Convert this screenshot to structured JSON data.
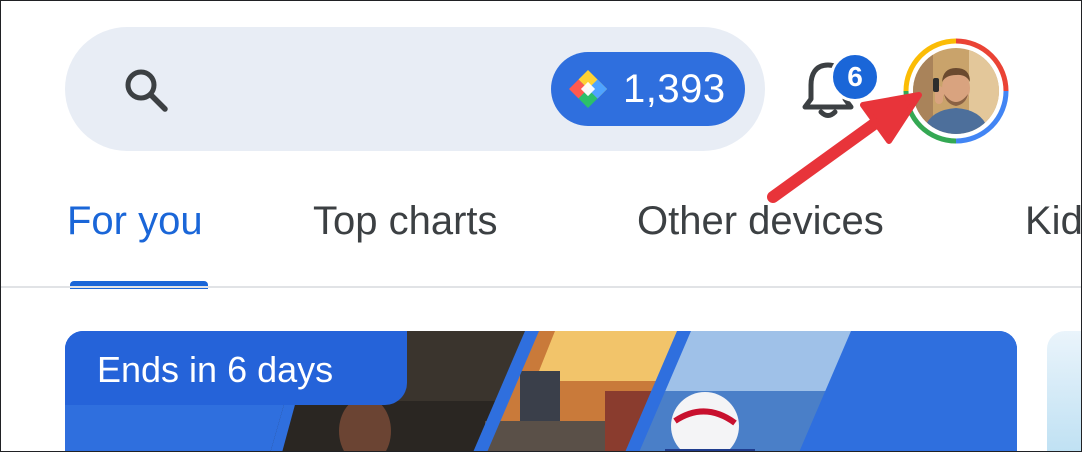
{
  "search": {
    "icon": "search-icon",
    "points": {
      "icon": "play-points-icon",
      "value": "1,393"
    }
  },
  "notifications": {
    "icon": "bell-icon",
    "count": "6"
  },
  "profile": {
    "icon": "avatar"
  },
  "tabs": [
    {
      "label": "For you",
      "active": true
    },
    {
      "label": "Top charts",
      "active": false
    },
    {
      "label": "Other devices",
      "active": false
    },
    {
      "label": "Kid",
      "active": false
    }
  ],
  "banner": {
    "badge": "Ends in 6 days"
  },
  "colors": {
    "accent": "#1a66d8",
    "search_bg": "#e8edf5",
    "points_chip": "#2f6fde",
    "annotation_arrow": "#e8343a"
  }
}
